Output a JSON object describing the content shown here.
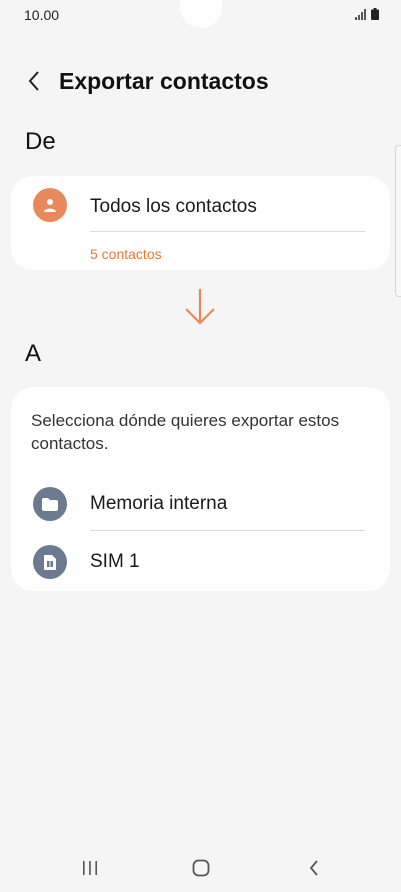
{
  "status_bar": {
    "time": "10.00"
  },
  "header": {
    "title": "Exportar contactos"
  },
  "from_section": {
    "label": "De",
    "option": {
      "label": "Todos los contactos",
      "count": "5 contactos"
    }
  },
  "to_section": {
    "label": "A",
    "description": "Selecciona dónde quieres exportar estos contactos.",
    "options": [
      {
        "label": "Memoria interna",
        "icon": "folder-icon"
      },
      {
        "label": "SIM 1",
        "icon": "sim-card-icon"
      }
    ]
  },
  "colors": {
    "accent": "#e8895c",
    "contact_icon_bg": "#e8895c",
    "option_icon_bg": "#6b7a90",
    "count_text": "#e07b3c"
  }
}
